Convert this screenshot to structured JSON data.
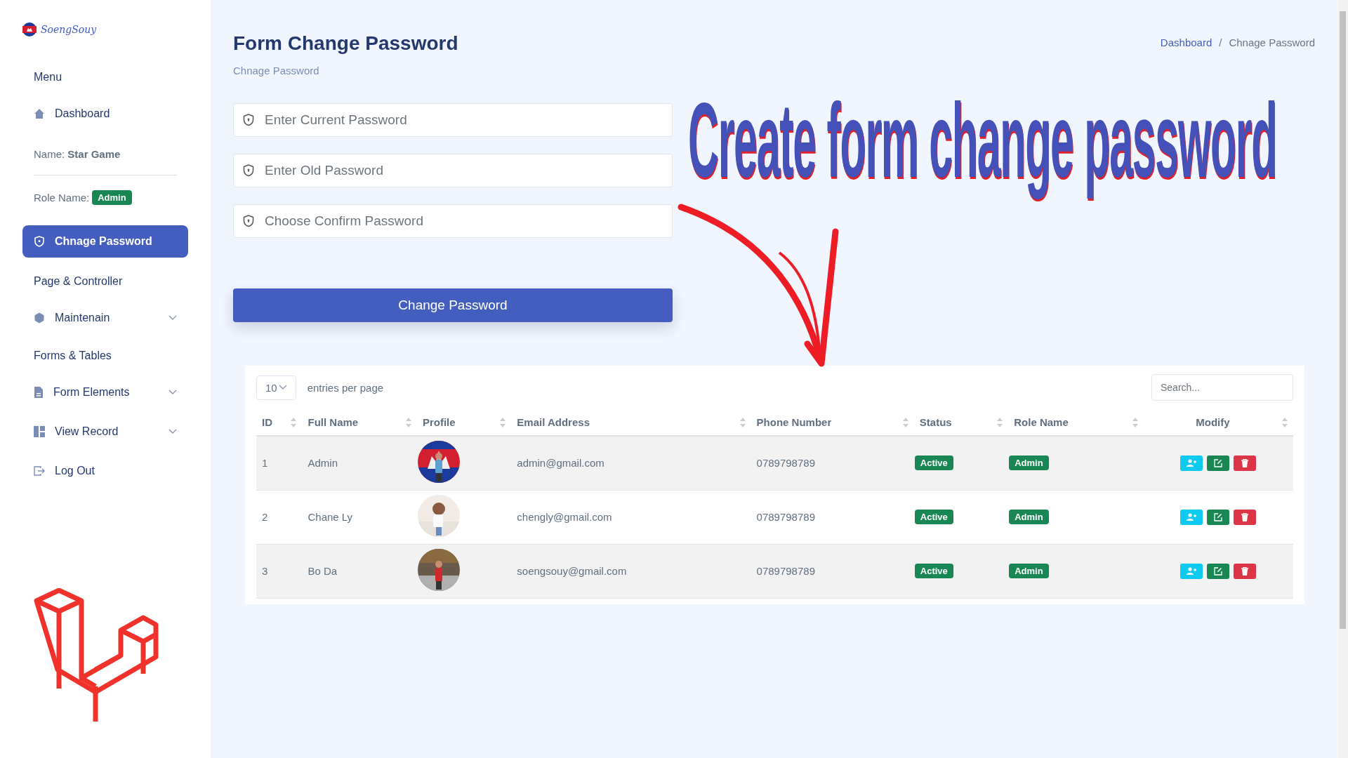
{
  "sidebar": {
    "logo": "SoengSouy",
    "items": [
      {
        "kind": "heading",
        "label": "Menu"
      },
      {
        "kind": "link",
        "label": "Dashboard",
        "selected": false,
        "expandable": false
      },
      {
        "kind": "name",
        "label": "Name:",
        "value": "Star Game"
      },
      {
        "kind": "role",
        "label": "Role Name:",
        "value": "Admin"
      },
      {
        "kind": "link",
        "label": "Chnage Password",
        "selected": true,
        "expandable": false
      },
      {
        "kind": "heading",
        "label": "Page & Controller"
      },
      {
        "kind": "link",
        "label": "Maintenain",
        "selected": false,
        "expandable": true
      },
      {
        "kind": "heading",
        "label": "Forms & Tables"
      },
      {
        "kind": "link",
        "label": "Form Elements",
        "selected": false,
        "expandable": true
      },
      {
        "kind": "link",
        "label": "View Record",
        "selected": false,
        "expandable": true
      },
      {
        "kind": "link",
        "label": "Log Out",
        "selected": false,
        "expandable": false
      }
    ]
  },
  "page": {
    "title": "Form Change Password",
    "subtitle": "Chnage Password",
    "breadcrumb": [
      "Dashboard",
      "Chnage Password"
    ],
    "breadcrumb_separator": "/"
  },
  "form": {
    "fields": [
      {
        "placeholder": "Enter Current Password"
      },
      {
        "placeholder": "Enter Old Password"
      },
      {
        "placeholder": "Choose Confirm Password"
      }
    ],
    "submit": "Change Password"
  },
  "overlay": {
    "caption": "Create form change password"
  },
  "table": {
    "entries": "10",
    "entries_label": "entries per page",
    "search": {
      "placeholder": "Search..."
    },
    "columns": [
      "ID",
      "Full Name",
      "Profile",
      "Email Address",
      "Phone Number",
      "Status",
      "Role Name",
      "Modify"
    ],
    "rows": [
      {
        "id": "1",
        "name": "Admin",
        "email": "admin@gmail.com",
        "phone": "0789798789",
        "status": "Active",
        "role": "Admin"
      },
      {
        "id": "2",
        "name": "Chane Ly",
        "email": "chengly@gmail.com",
        "phone": "0789798789",
        "status": "Active",
        "role": "Admin"
      },
      {
        "id": "3",
        "name": "Bo Da",
        "email": "soengsouy@gmail.com",
        "phone": "0789798789",
        "status": "Active",
        "role": "Admin"
      }
    ]
  }
}
